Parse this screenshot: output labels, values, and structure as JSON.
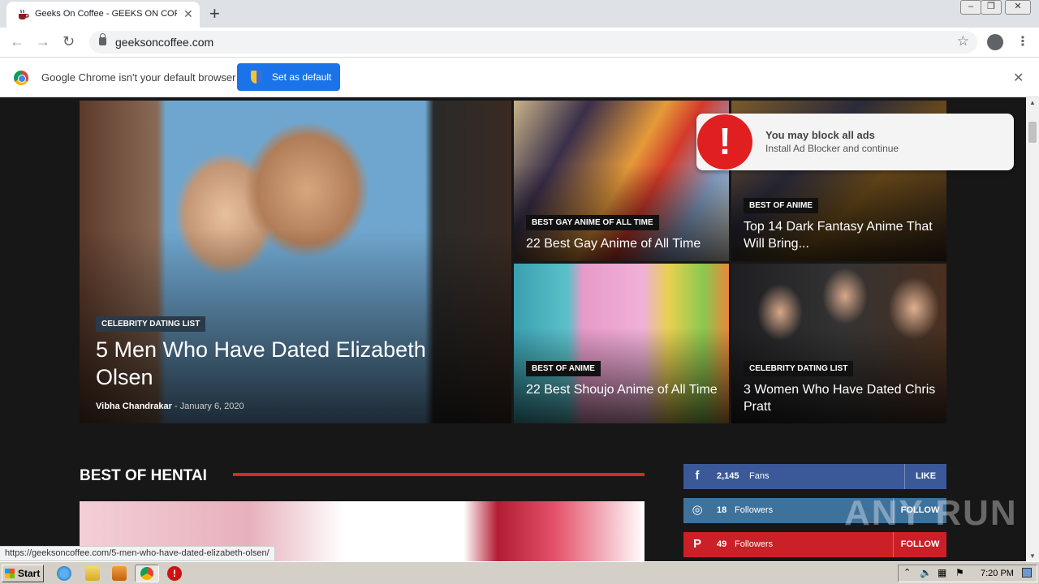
{
  "browser": {
    "tab_title": "Geeks On Coffee - GEEKS ON COFFEE",
    "url": "geeksoncoffee.com",
    "infobar_text": "Google Chrome isn't your default browser",
    "infobar_button": "Set as default",
    "status_url": "https://geeksoncoffee.com/5-men-who-have-dated-elizabeth-olsen/"
  },
  "featured": {
    "main": {
      "badge": "CELEBRITY DATING LIST",
      "title": "5 Men Who Have Dated Elizabeth Olsen",
      "author": "Vibha Chandrakar",
      "separator": "-",
      "date": "January 6, 2020"
    },
    "grid": [
      {
        "badge": "BEST GAY ANIME OF ALL TIME",
        "title": "22 Best Gay Anime of All Time"
      },
      {
        "badge": "BEST OF ANIME",
        "title": "Top 14 Dark Fantasy Anime That Will Bring..."
      },
      {
        "badge": "BEST OF ANIME",
        "title": "22 Best Shoujo Anime of All Time"
      },
      {
        "badge": "CELEBRITY DATING LIST",
        "title": "3 Women Who Have Dated Chris Pratt"
      }
    ]
  },
  "section": {
    "title": "BEST OF HENTAI"
  },
  "social": [
    {
      "icon": "f",
      "count": "2,145",
      "unit": "Fans",
      "action": "LIKE",
      "color": "#3b5998"
    },
    {
      "icon": "◎",
      "count": "18",
      "unit": "Followers",
      "action": "FOLLOW",
      "color": "#3f729b"
    },
    {
      "icon": "P",
      "count": "49",
      "unit": "Followers",
      "action": "FOLLOW",
      "color": "#cb2027"
    }
  ],
  "ad_popup": {
    "icon": "!",
    "title": "You may block all ads",
    "subtitle": "Install Ad Blocker and continue"
  },
  "watermark": "ANY RUN",
  "taskbar": {
    "start_label": "Start",
    "clock": "7:20 PM"
  }
}
